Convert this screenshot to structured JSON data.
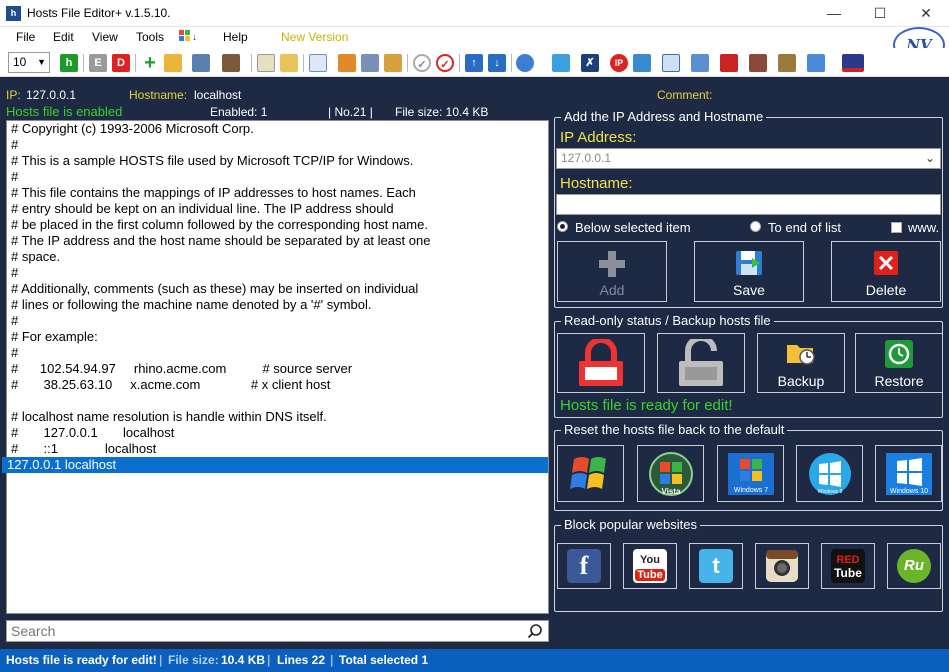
{
  "window": {
    "title": "Hosts File Editor+ v.1.5.10.",
    "app_icon": "h"
  },
  "menu": {
    "file": "File",
    "edit": "Edit",
    "view": "View",
    "tools": "Tools",
    "help": "Help",
    "new_version": "New Version"
  },
  "toolbar": {
    "font_size": "10"
  },
  "info": {
    "ip_label": "IP:",
    "ip_value": "127.0.0.1",
    "hostname_label": "Hostname:",
    "hostname_value": "localhost",
    "comment_label": "Comment:"
  },
  "status": {
    "enabled_text": "Hosts file is enabled",
    "enabled_count": "Enabled: 1",
    "number": "| No.21 |",
    "file_size": "File size: 10.4 KB"
  },
  "editor_lines": [
    "# Copyright (c) 1993-2006 Microsoft Corp.",
    "#",
    "# This is a sample HOSTS file used by Microsoft TCP/IP for Windows.",
    "#",
    "# This file contains the mappings of IP addresses to host names. Each",
    "# entry should be kept on an individual line. The IP address should",
    "# be placed in the first column followed by the corresponding host name.",
    "# The IP address and the host name should be separated by at least one",
    "# space.",
    "#",
    "# Additionally, comments (such as these) may be inserted on individual",
    "# lines or following the machine name denoted by a '#' symbol.",
    "#",
    "# For example:",
    "#",
    "#      102.54.94.97     rhino.acme.com          # source server",
    "#       38.25.63.10     x.acme.com              # x client host",
    "",
    "# localhost name resolution is handle within DNS itself.",
    "#       127.0.0.1       localhost",
    "#       ::1             localhost",
    "127.0.0.1 localhost"
  ],
  "search": {
    "placeholder": "Search"
  },
  "add_panel": {
    "legend": "Add the IP Address  and Hostname",
    "ip_label": "IP Address:",
    "ip_value": "127.0.0.1",
    "hostname_label": "Hostname:",
    "hostname_value": "",
    "opt_below": "Below selected item",
    "opt_end": "To end of list",
    "opt_www": "www.",
    "add": "Add",
    "save": "Save",
    "delete": "Delete"
  },
  "readonly_panel": {
    "legend": "Read-only status / Backup hosts file",
    "backup": "Backup",
    "restore": "Restore",
    "ready": "Hosts file is ready for edit!"
  },
  "reset_panel": {
    "legend": "Reset the hosts file back to the default",
    "items": [
      "Windows XP",
      "Vista",
      "Windows 7",
      "Windows 8",
      "Windows 10"
    ]
  },
  "block_panel": {
    "legend": "Block popular websites",
    "items": [
      "facebook",
      "YouTube",
      "twitter",
      "instagram",
      "RedTube",
      "Ru"
    ]
  },
  "bottom": {
    "ready": "Hosts file is ready for edit!",
    "size_label": "File size:",
    "size_value": "10.4 KB",
    "lines": "Lines 22",
    "selected": "Total selected 1"
  },
  "colors": {
    "accent_yellow": "#e8d23a",
    "ok_green": "#39d12b",
    "panel_bg": "#1e2a44",
    "status_blue": "#0a5fbf"
  }
}
